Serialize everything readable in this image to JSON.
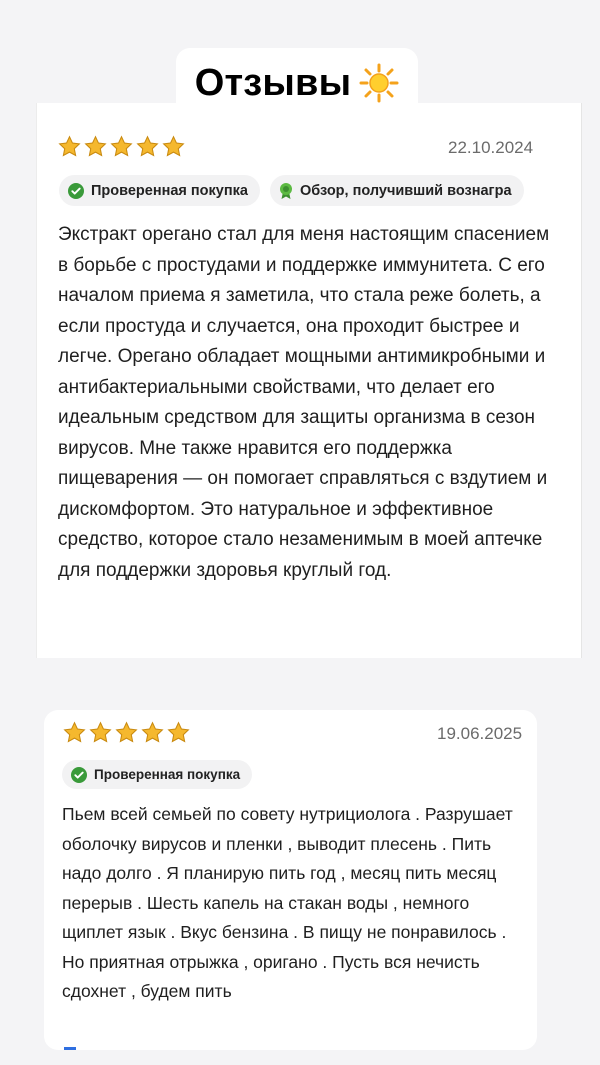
{
  "header": {
    "title": "Отзывы",
    "title_icon": "sun-emoji-icon"
  },
  "colors": {
    "star": "#f5b82e",
    "check_green": "#3a9a3a",
    "ribbon_green": "#4caa3a"
  },
  "reviews": [
    {
      "rating": 5,
      "date": "22.10.2024",
      "badges": [
        "Проверенная покупка",
        "Обзор, получивший вознагра"
      ],
      "text": "Экстракт орегано стал для меня настоящим спасением в борьбе с простудами и поддержке иммунитета. С его началом приема я заметила, что стала реже болеть, а если простуда и случается, она проходит быстрее и легче. Орегано обладает мощными антимикробными и антибактериальными свойствами, что делает его идеальным средством для защиты организма в сезон вирусов. Мне также нравится его поддержка пищеварения — он помогает справляться с вздутием и дискомфортом. Это натуральное и эффективное средство, которое стало незаменимым в моей аптечке для поддержки здоровья круглый год."
    },
    {
      "rating": 5,
      "date": "19.06.2025",
      "badges": [
        "Проверенная покупка"
      ],
      "text": "Пьем всей семьей по совету нутрициолога . Разрушает оболочку вирусов и пленки , выводит плесень . Пить надо долго . Я планирую пить год , месяц пить месяц перерыв . Шесть капель на стакан воды , немного щиплет язык . Вкус бензина . В пищу не понравилось . Но приятная отрыжка , оригано . Пусть вся нечисть сдохнет , будем пить"
    }
  ]
}
